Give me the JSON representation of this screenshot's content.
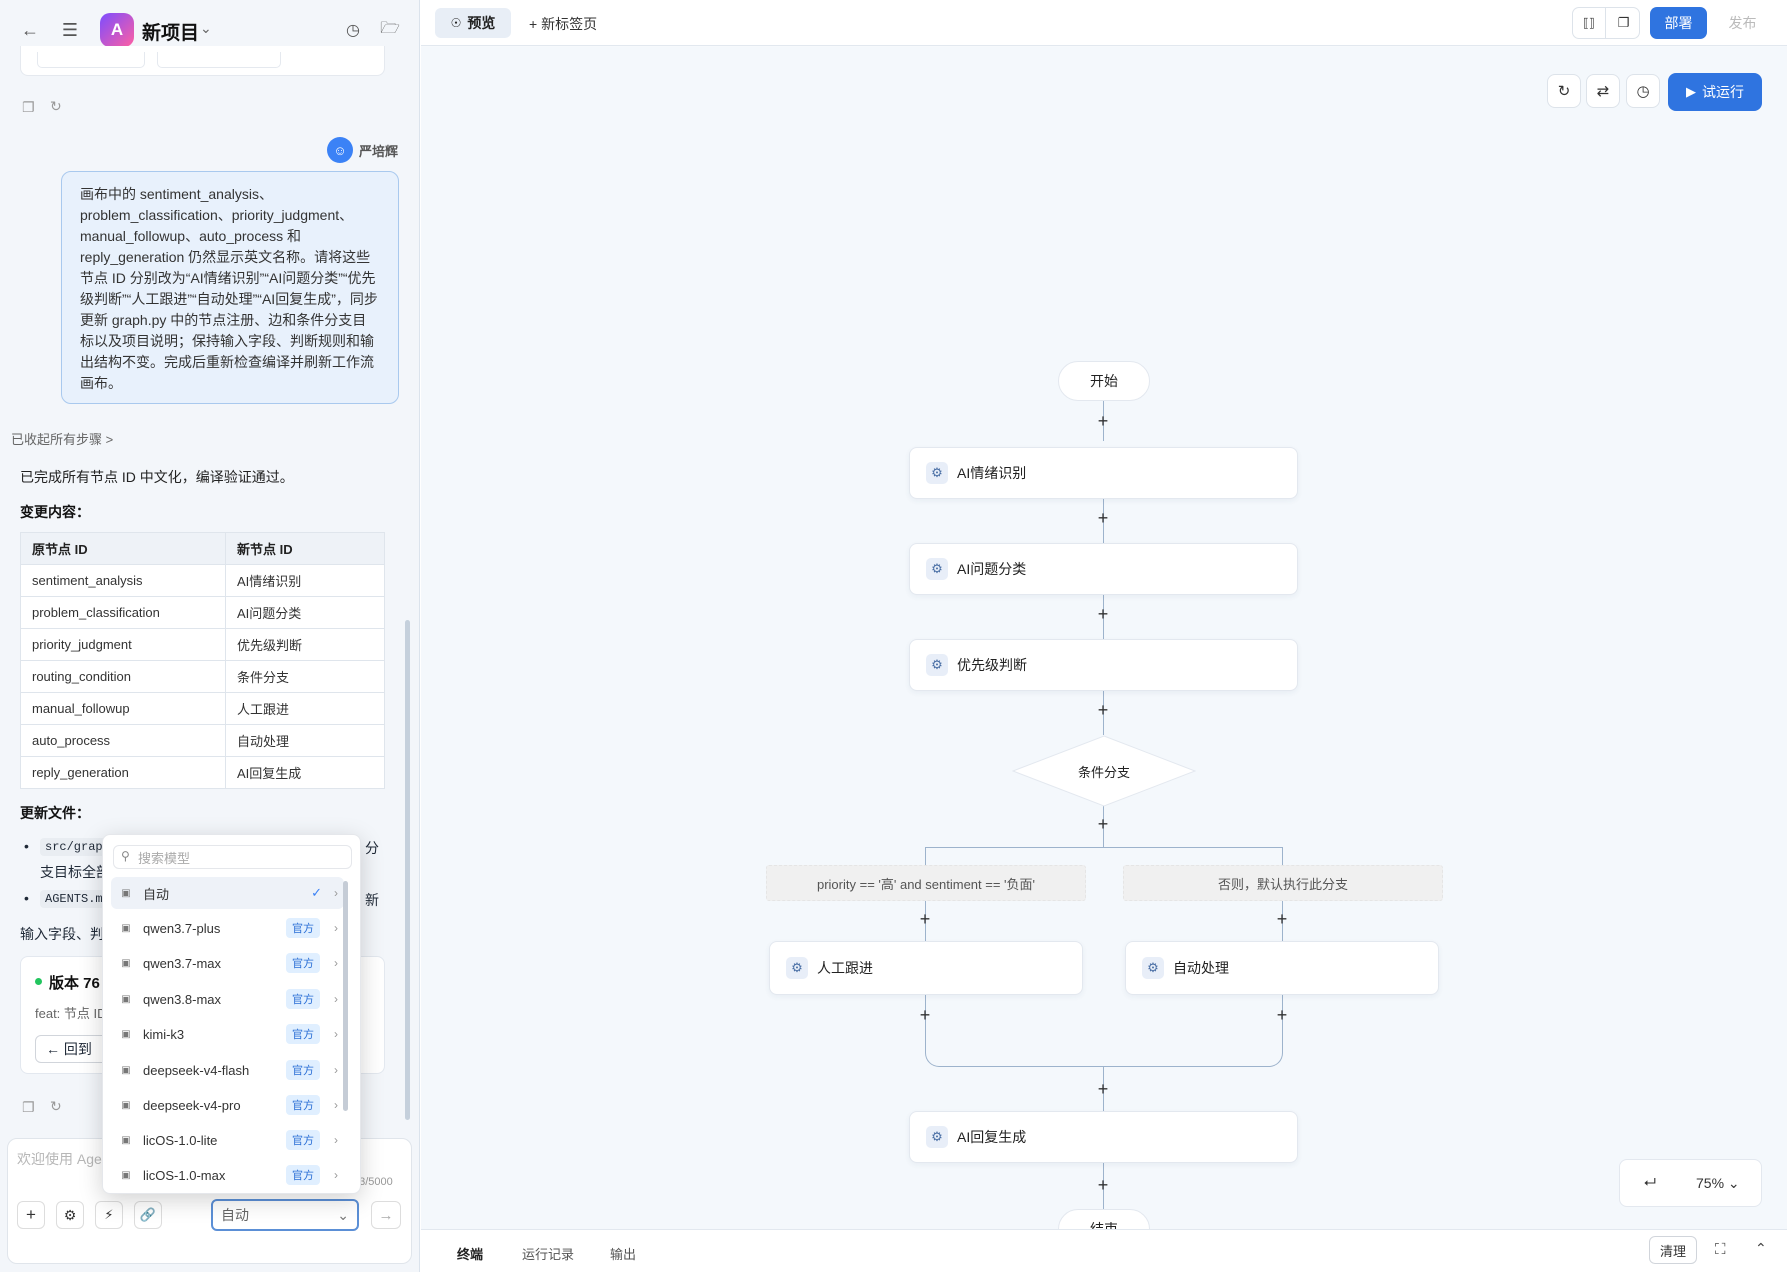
{
  "header": {
    "project_title": "新项目",
    "logo_letter": "A"
  },
  "chat": {
    "user_name": "严培辉",
    "user_message": "画布中的 sentiment_analysis、problem_classification、priority_judgment、manual_followup、auto_process 和 reply_generation 仍然显示英文名称。请将这些节点 ID 分别改为“AI情绪识别”“AI问题分类”“优先级判断”“人工跟进”“自动处理”“AI回复生成”，同步更新 graph.py 中的节点注册、边和条件分支目标以及项目说明；保持输入字段、判断规则和输出结构不变。完成后重新检查编译并刷新工作流画布。",
    "collapsed_steps": "已收起所有步骤",
    "summary": "已完成所有节点 ID 中文化，编译验证通过。",
    "changes_title": "变更内容",
    "table_headers": [
      "原节点 ID",
      "新节点 ID"
    ],
    "table_rows": [
      [
        "sentiment_analysis",
        "AI情绪识别"
      ],
      [
        "problem_classification",
        "AI问题分类"
      ],
      [
        "priority_judgment",
        "优先级判断"
      ],
      [
        "routing_condition",
        "条件分支"
      ],
      [
        "manual_followup",
        "人工跟进"
      ],
      [
        "auto_process",
        "自动处理"
      ],
      [
        "reply_generation",
        "AI回复生成"
      ]
    ],
    "updated_files_title": "更新文件",
    "file1_code": "src/grap",
    "file1_tail": "分",
    "file1_line2": "支目标全部",
    "file2_code": "AGENTS.m",
    "file2_tail": "新",
    "line3": "输入字段、判",
    "version_title": "版本 76",
    "version_desc": "feat: 节点 ID",
    "version_back": "回到",
    "input_placeholder": "欢迎使用 Agen",
    "char_count": "63/5000",
    "model_select": "自动"
  },
  "model_dropdown": {
    "search_placeholder": "搜索模型",
    "items": [
      {
        "name": "自动",
        "badge": ""
      },
      {
        "name": "qwen3.7-plus",
        "badge": "官方"
      },
      {
        "name": "qwen3.7-max",
        "badge": "官方"
      },
      {
        "name": "qwen3.8-max",
        "badge": "官方"
      },
      {
        "name": "kimi-k3",
        "badge": "官方"
      },
      {
        "name": "deepseek-v4-flash",
        "badge": "官方"
      },
      {
        "name": "deepseek-v4-pro",
        "badge": "官方"
      },
      {
        "name": "licOS-1.0-lite",
        "badge": "官方"
      },
      {
        "name": "licOS-1.0-max",
        "badge": "官方"
      }
    ]
  },
  "tabs": {
    "preview": "预览",
    "new_tab": "新标签页"
  },
  "actions": {
    "deploy": "部署",
    "publish": "发布",
    "trial_run": "试运行"
  },
  "workflow": {
    "start": "开始",
    "n1": "AI情绪识别",
    "n2": "AI问题分类",
    "n3": "优先级判断",
    "condition": "条件分支",
    "branch_left": "priority == '高' and sentiment == '负面'",
    "branch_right": "否则，默认执行此分支",
    "left_node": "人工跟进",
    "right_node": "自动处理",
    "n_reply": "AI回复生成",
    "end": "结束"
  },
  "zoom": "75%",
  "bottom_tabs": {
    "terminal": "终端",
    "run_log": "运行记录",
    "output": "输出",
    "clear": "清理"
  }
}
